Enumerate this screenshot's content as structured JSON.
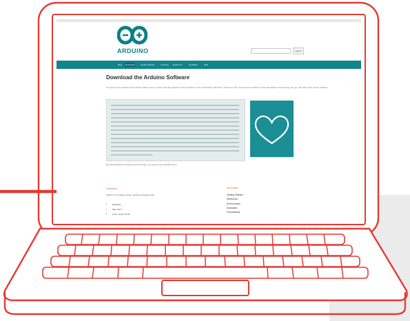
{
  "screen": {
    "logo_text": "ARDUINO",
    "search": {
      "placeholder": "",
      "button_label": "search"
    },
    "nav": [
      {
        "label": "Blog"
      },
      {
        "label": "Download"
      },
      {
        "label": "Getting Started"
      },
      {
        "label": "Learning"
      },
      {
        "label": "Reference"
      },
      {
        "label": "Hardware"
      },
      {
        "label": "FAQ"
      }
    ],
    "heading": "Download the Arduino Software",
    "intro": "The open-source Arduino environment makes it easy to write code and upload it to the i/o board. It runs on Windows, Mac OS X, and Linux. The environment is written in Java and based on Processing, avr-gcc, and other open source software.",
    "download_note": "By downloading the software from this page, you agree to the specified terms.",
    "download_section": {
      "title": "Download",
      "filename": "Arduino 1.0 (release notes), hosted by Google Code:",
      "platforms": [
        "Windows",
        "Mac OS X",
        "Linux: 32 bit, 64 bit"
      ]
    },
    "next_steps": {
      "title": "Next steps",
      "links": [
        "Getting Started",
        "Reference",
        "Environment",
        "Examples",
        "Foundations"
      ]
    }
  },
  "colors": {
    "outline": "#e33a33",
    "arrow": "#e33a33",
    "teal": "#12848b",
    "orange_text": "#d4693a"
  }
}
